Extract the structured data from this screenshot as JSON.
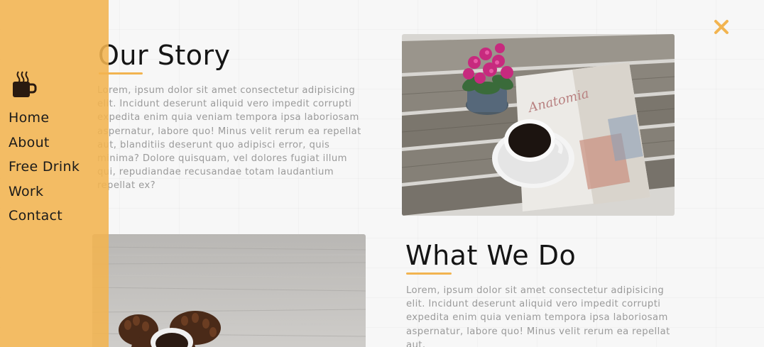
{
  "sidebar": {
    "logo_icon": "coffee-cup-icon",
    "nav": [
      "Home",
      "About",
      "Free Drink",
      "Work",
      "Contact"
    ]
  },
  "close_icon": "close-icon",
  "story": {
    "title": "Our Story",
    "text": "Lorem, ipsum dolor sit amet consectetur adipisicing elit. Incidunt deserunt aliquid vero impedit corrupti expedita enim quia veniam tempora ipsa laboriosam aspernatur, labore quo! Minus velit rerum ea repellat aut, blanditiis deserunt quo adipisci error, quis minima? Dolore quisquam, vel dolores fugiat illum qui, repudiandae recusandae totam laudantium repellat ex?"
  },
  "what_we_do": {
    "title": "What We Do",
    "text": "Lorem, ipsum dolor sit amet consectetur adipisicing elit. Incidunt deserunt aliquid vero impedit corrupti expedita enim quia veniam tempora ipsa laboriosam aspernatur, labore quo! Minus velit rerum ea repellat aut,"
  },
  "colors": {
    "accent": "#f2b450",
    "heading": "#151515",
    "body_text": "#9a9a9a"
  }
}
